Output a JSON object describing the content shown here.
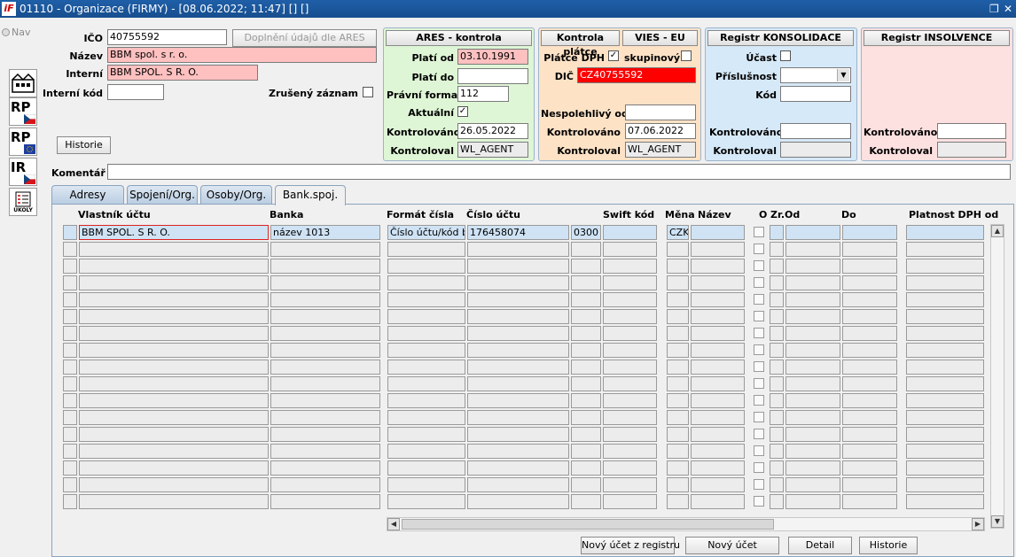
{
  "window": {
    "title": "01110 - Organizace (FIRMY) - [08.06.2022; 11:47] [] []",
    "logo": "iF",
    "restore": "❐",
    "close": "✕"
  },
  "sidebar": {
    "nav_label": "Nav",
    "icons": [
      {
        "name": "organization-icon",
        "label": "🏢"
      },
      {
        "name": "rp-cz-icon",
        "label": "RP"
      },
      {
        "name": "rp-eu-icon",
        "label": "RP"
      },
      {
        "name": "ir-cz-icon",
        "label": "IR"
      },
      {
        "name": "ukoly-icon",
        "label": "ÚKOLY"
      }
    ]
  },
  "form": {
    "ico": {
      "label": "IČO",
      "value": "40755592"
    },
    "ares_fill_button": "Doplnění údajů dle ARES",
    "nazev": {
      "label": "Název",
      "value": "BBM spol. s r. o."
    },
    "interni": {
      "label": "Interní",
      "value": "BBM SPOL. S R. O."
    },
    "interni_kod": {
      "label": "Interní kód",
      "value": ""
    },
    "zruseny": {
      "label": "Zrušený záznam",
      "checked": false
    },
    "historie_button": "Historie",
    "komentar": {
      "label": "Komentář",
      "value": ""
    }
  },
  "ares": {
    "title": "ARES - kontrola",
    "plati_od": {
      "label": "Platí od",
      "value": "03.10.1991"
    },
    "plati_do": {
      "label": "Platí do",
      "value": ""
    },
    "pravni_forma": {
      "label": "Právní forma",
      "value": "112"
    },
    "aktualni": {
      "label": "Aktuální",
      "check": "✓"
    },
    "kontrolovano": {
      "label": "Kontrolováno",
      "value": "26.05.2022"
    },
    "kontroloval": {
      "label": "Kontroloval",
      "value": "WL_AGENT"
    }
  },
  "platce": {
    "title": "Kontrola plátce",
    "vies_title": "VIES - EU",
    "platce_dph": {
      "label": "Plátce DPH",
      "check": "✓"
    },
    "skupinovy": {
      "label": "skupinový"
    },
    "dic": {
      "label": "DIČ",
      "value": "CZ40755592"
    },
    "nespolehlivy": {
      "label": "Nespolehlivý od",
      "value": ""
    },
    "kontrolovano": {
      "label": "Kontrolováno",
      "value": "07.06.2022"
    },
    "kontroloval": {
      "label": "Kontroloval",
      "value": "WL_AGENT"
    }
  },
  "konsolidace": {
    "title": "Registr KONSOLIDACE",
    "ucast": {
      "label": "Účast"
    },
    "prislusnost": {
      "label": "Příslušnost",
      "value": ""
    },
    "kod": {
      "label": "Kód",
      "value": ""
    },
    "kontrolovano": {
      "label": "Kontrolováno",
      "value": ""
    },
    "kontroloval": {
      "label": "Kontroloval",
      "value": ""
    }
  },
  "insolvence": {
    "title": "Registr INSOLVENCE",
    "kontrolovano": {
      "label": "Kontrolováno",
      "value": ""
    },
    "kontroloval": {
      "label": "Kontroloval",
      "value": ""
    }
  },
  "tabs": [
    {
      "label": "Adresy"
    },
    {
      "label": "Spojení/Org."
    },
    {
      "label": "Osoby/Org."
    },
    {
      "label": "Bank.spoj."
    }
  ],
  "grid": {
    "headers": {
      "vlastnik": "Vlastník účtu",
      "banka": "Banka",
      "format": "Formát čísla",
      "cislo": "Číslo účtu",
      "swift": "Swift kód",
      "mena": "Měna",
      "nazev": "Název",
      "o": "O",
      "zrod": "Zr.Od",
      "do": "Do",
      "platnost": "Platnost DPH od"
    },
    "rows": [
      {
        "vlastnik": "BBM SPOL. S R. O.",
        "banka": "název 1013",
        "format": "Číslo účtu/kód banky",
        "cislo": "176458074",
        "kod": "0300",
        "swift": "",
        "mena": "CZK",
        "nazev": "",
        "zrod": "",
        "do": "",
        "platnost": ""
      }
    ]
  },
  "buttons": {
    "novy_registr": "Nový účet z registru",
    "novy": "Nový účet",
    "detail": "Detail",
    "historie": "Historie"
  }
}
